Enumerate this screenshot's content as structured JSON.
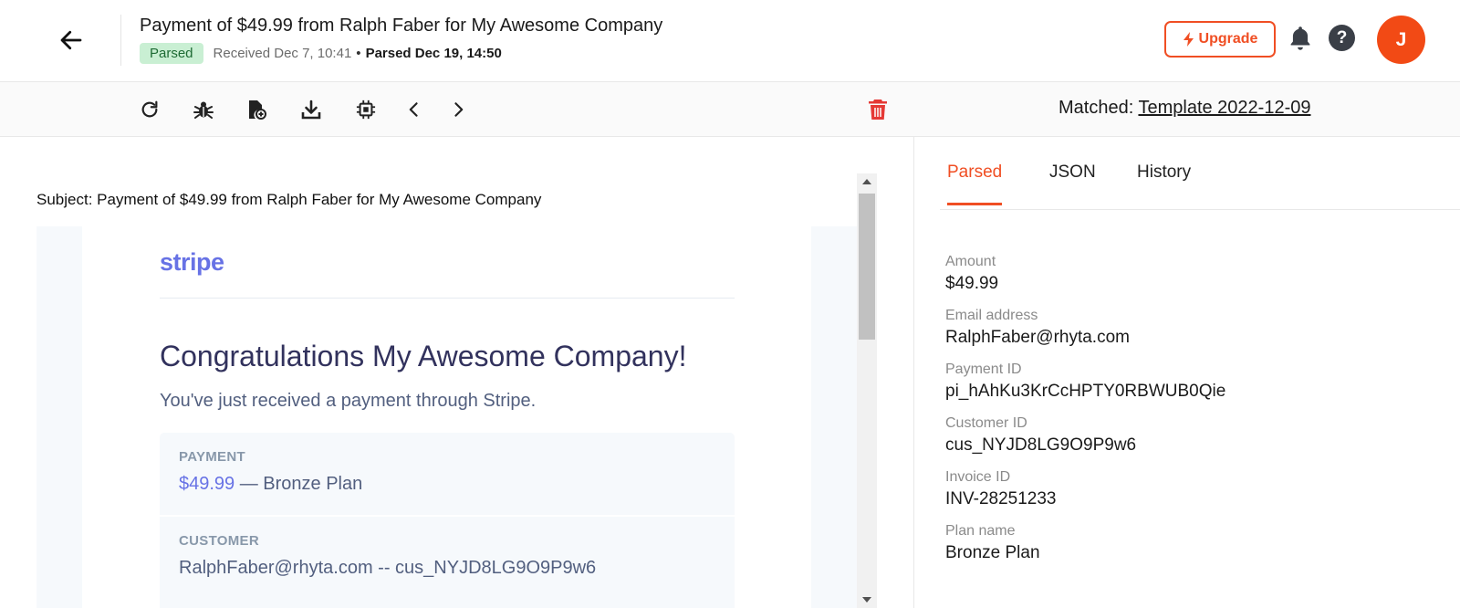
{
  "header": {
    "title": "Payment of $49.99 from Ralph Faber for My Awesome Company",
    "status_badge": "Parsed",
    "received": "Received Dec 7, 10:41",
    "separator": "•",
    "parsed_at": "Parsed Dec 19, 14:50",
    "upgrade_label": "Upgrade",
    "help_label": "?",
    "avatar_initial": "J",
    "accent_color": "#f04e23"
  },
  "toolbar": {
    "icons": [
      "refresh-icon",
      "bug-icon",
      "add-file-icon",
      "download-icon",
      "chip-icon",
      "chevron-left-icon",
      "chevron-right-icon",
      "trash-icon"
    ],
    "matched_label": "Matched:",
    "matched_template": "Template 2022-12-09"
  },
  "email": {
    "subject": "Subject: Payment of $49.99 from Ralph Faber for My Awesome Company",
    "logo": "stripe",
    "heading": "Congratulations My Awesome Company!",
    "message": "You've just received a payment through Stripe.",
    "payment_label": "PAYMENT",
    "payment_amount": "$49.99",
    "payment_plan": " — Bronze Plan",
    "customer_label": "CUSTOMER",
    "customer_value": "RalphFaber@rhyta.com -- cus_NYJD8LG9O9P9w6"
  },
  "tabs": [
    {
      "label": "Parsed",
      "active": true
    },
    {
      "label": "JSON",
      "active": false
    },
    {
      "label": "History",
      "active": false
    }
  ],
  "fields": [
    {
      "label": "Amount",
      "value": "$49.99"
    },
    {
      "label": "Email address",
      "value": "RalphFaber@rhyta.com"
    },
    {
      "label": "Payment ID",
      "value": "pi_hAhKu3KrCcHPTY0RBWUB0Qie"
    },
    {
      "label": "Customer ID",
      "value": "cus_NYJD8LG9O9P9w6"
    },
    {
      "label": "Invoice ID",
      "value": "INV-28251233"
    },
    {
      "label": "Plan name",
      "value": "Bronze Plan"
    }
  ]
}
